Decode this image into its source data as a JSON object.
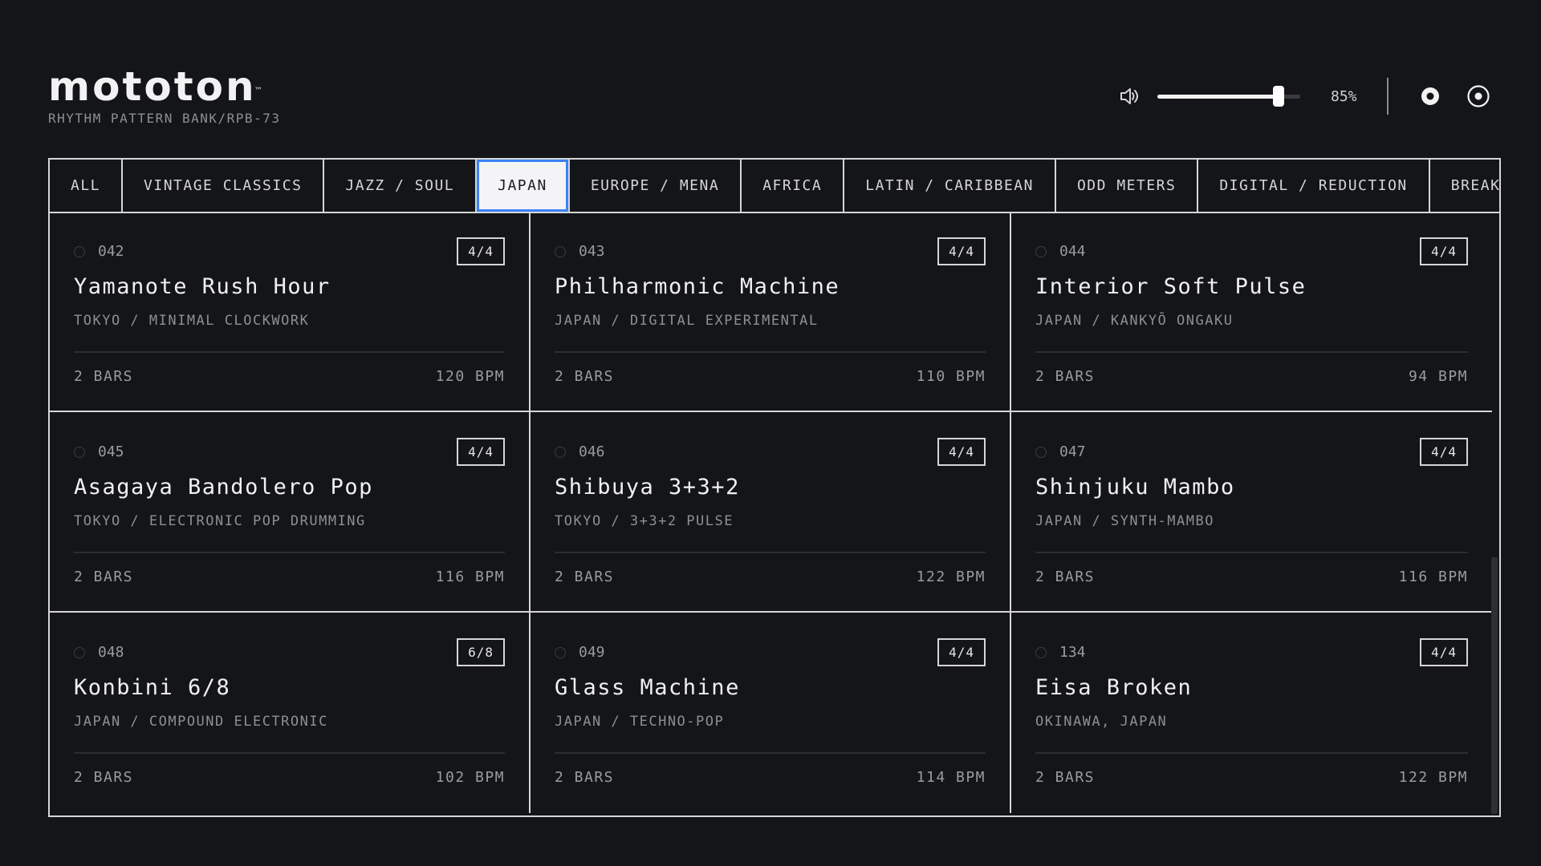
{
  "header": {
    "logo": "mototon",
    "trademark": "™",
    "subtitle": "RHYTHM PATTERN BANK/RPB-73"
  },
  "volume": {
    "level": 0.85,
    "label": "85%"
  },
  "icons": {
    "volume": "speaker-icon",
    "record": "record-icon",
    "target": "target-icon"
  },
  "colors": {
    "background": "#141518",
    "active_tab_border": "#3b82f6",
    "foreground": "#e6e6e6"
  },
  "tabs": [
    {
      "label": "ALL",
      "active": false
    },
    {
      "label": "VINTAGE CLASSICS",
      "active": false
    },
    {
      "label": "JAZZ / SOUL",
      "active": false
    },
    {
      "label": "JAPAN",
      "active": true
    },
    {
      "label": "EUROPE / MENA",
      "active": false
    },
    {
      "label": "AFRICA",
      "active": false
    },
    {
      "label": "LATIN / CARIBBEAN",
      "active": false
    },
    {
      "label": "ODD METERS",
      "active": false
    },
    {
      "label": "DIGITAL / REDUCTION",
      "active": false
    },
    {
      "label": "BREAKS",
      "active": false
    }
  ],
  "patterns": [
    {
      "num": "042",
      "meter": "4/4",
      "title": "Yamanote Rush Hour",
      "subtitle": "TOKYO / MINIMAL CLOCKWORK",
      "bars": "2 BARS",
      "bpm": "120 BPM"
    },
    {
      "num": "043",
      "meter": "4/4",
      "title": "Philharmonic Machine",
      "subtitle": "JAPAN / DIGITAL EXPERIMENTAL",
      "bars": "2 BARS",
      "bpm": "110 BPM"
    },
    {
      "num": "044",
      "meter": "4/4",
      "title": "Interior Soft Pulse",
      "subtitle": "JAPAN / KANKYŌ ONGAKU",
      "bars": "2 BARS",
      "bpm": "94 BPM"
    },
    {
      "num": "045",
      "meter": "4/4",
      "title": "Asagaya Bandolero Pop",
      "subtitle": "TOKYO / ELECTRONIC POP DRUMMING",
      "bars": "2 BARS",
      "bpm": "116 BPM"
    },
    {
      "num": "046",
      "meter": "4/4",
      "title": "Shibuya 3+3+2",
      "subtitle": "TOKYO / 3+3+2 PULSE",
      "bars": "2 BARS",
      "bpm": "122 BPM"
    },
    {
      "num": "047",
      "meter": "4/4",
      "title": "Shinjuku Mambo",
      "subtitle": "JAPAN / SYNTH-MAMBO",
      "bars": "2 BARS",
      "bpm": "116 BPM"
    },
    {
      "num": "048",
      "meter": "6/8",
      "title": "Konbini 6/8",
      "subtitle": "JAPAN / COMPOUND ELECTRONIC",
      "bars": "2 BARS",
      "bpm": "102 BPM"
    },
    {
      "num": "049",
      "meter": "4/4",
      "title": "Glass Machine",
      "subtitle": "JAPAN / TECHNO-POP",
      "bars": "2 BARS",
      "bpm": "114 BPM"
    },
    {
      "num": "134",
      "meter": "4/4",
      "title": "Eisa Broken",
      "subtitle": "OKINAWA, JAPAN",
      "bars": "2 BARS",
      "bpm": "122 BPM"
    }
  ]
}
